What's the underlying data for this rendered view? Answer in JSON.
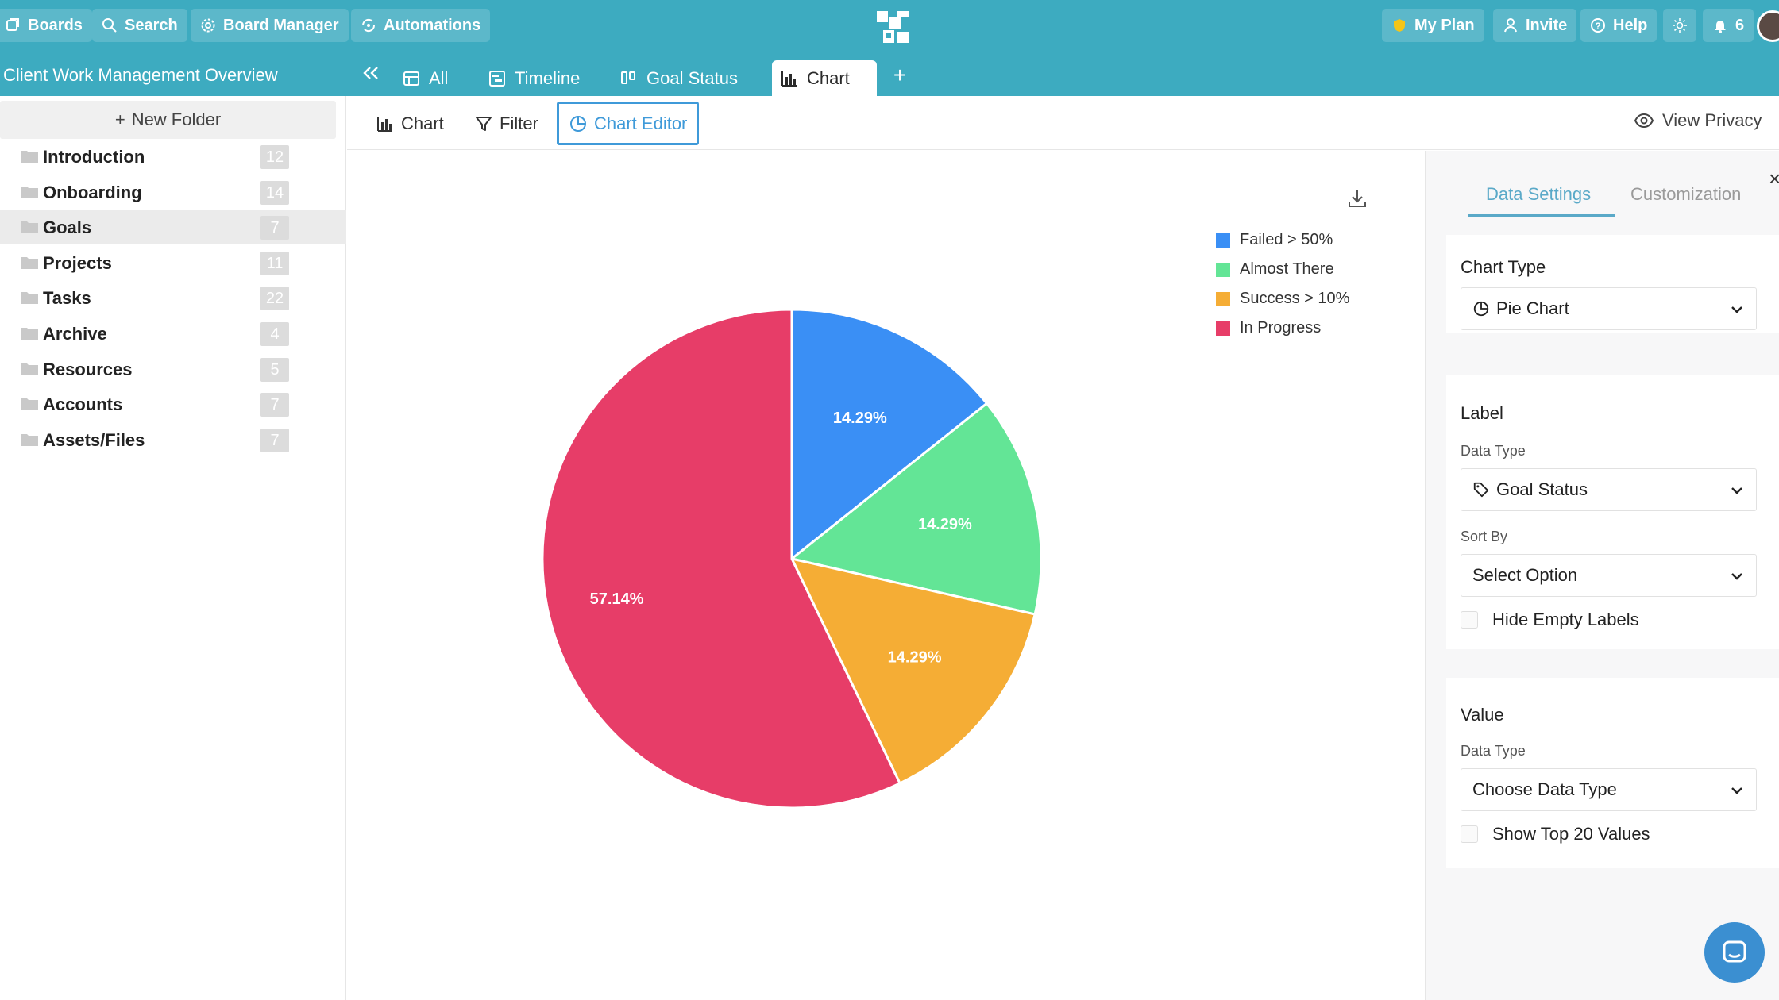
{
  "topbar": {
    "boards": "Boards",
    "search": "Search",
    "board_manager": "Board Manager",
    "automations": "Automations",
    "my_plan": "My Plan",
    "invite": "Invite",
    "help": "Help",
    "notifications_count": "6"
  },
  "subbar": {
    "board_title": "Client Work Management Overview",
    "tabs": [
      {
        "label": "All",
        "icon": "table-icon"
      },
      {
        "label": "Timeline",
        "icon": "timeline-icon"
      },
      {
        "label": "Goal Status",
        "icon": "goal-status-icon"
      },
      {
        "label": "Chart",
        "icon": "chart-icon",
        "active": true
      }
    ],
    "add_tab": "+"
  },
  "sidebar": {
    "new_folder": "New Folder",
    "folders": [
      {
        "label": "Introduction",
        "count": "12"
      },
      {
        "label": "Onboarding",
        "count": "14"
      },
      {
        "label": "Goals",
        "count": "7",
        "active": true
      },
      {
        "label": "Projects",
        "count": "11"
      },
      {
        "label": "Tasks",
        "count": "22"
      },
      {
        "label": "Archive",
        "count": "4"
      },
      {
        "label": "Resources",
        "count": "5"
      },
      {
        "label": "Accounts",
        "count": "7"
      },
      {
        "label": "Assets/Files",
        "count": "7"
      }
    ]
  },
  "toolbar": {
    "chart": "Chart",
    "filter": "Filter",
    "chart_editor": "Chart Editor",
    "view_privacy": "View Privacy"
  },
  "chart_data": {
    "type": "pie",
    "categories": [
      "Failed > 50%",
      "Almost There",
      "Success > 10%",
      "In Progress"
    ],
    "values": [
      14.29,
      14.29,
      14.29,
      57.14
    ],
    "labels": [
      "14.29%",
      "14.29%",
      "14.29%",
      "57.14%"
    ],
    "colors": [
      "#3a8ff5",
      "#63e596",
      "#f5ad35",
      "#e73d68"
    ],
    "legend_position": "top-right",
    "title": ""
  },
  "settings": {
    "tabs": [
      "Data Settings",
      "Customization"
    ],
    "chart_type_title": "Chart Type",
    "chart_type_value": "Pie Chart",
    "label_title": "Label",
    "label_data_type_label": "Data Type",
    "label_data_type_value": "Goal Status",
    "sort_by_label": "Sort By",
    "sort_by_value": "Select Option",
    "hide_empty_labels": "Hide Empty Labels",
    "value_title": "Value",
    "value_data_type_label": "Data Type",
    "value_data_type_value": "Choose Data Type",
    "show_top_20": "Show Top 20 Values",
    "close": "×"
  }
}
